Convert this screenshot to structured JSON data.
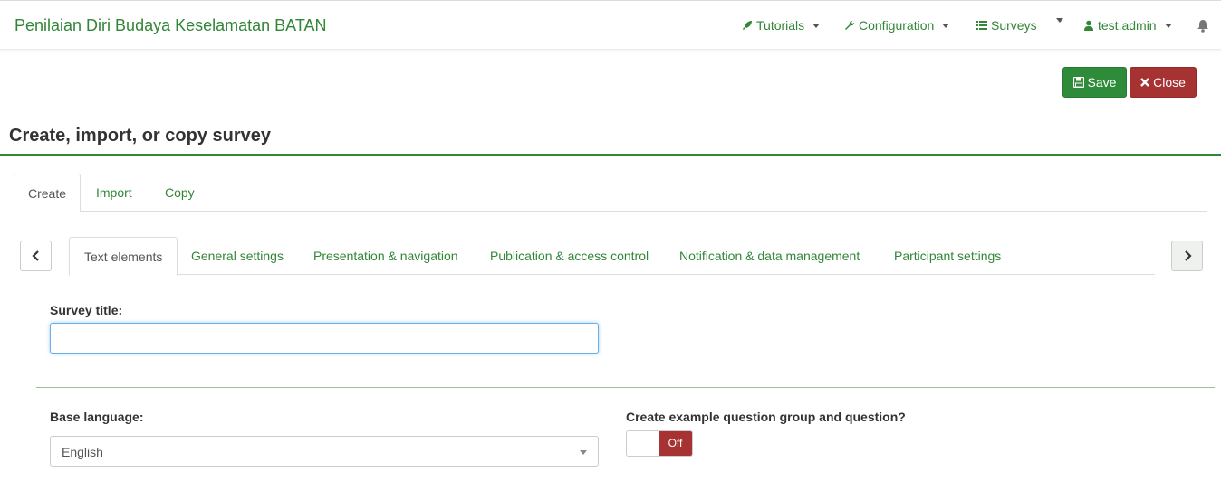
{
  "app": {
    "title": "Penilaian Diri Budaya Keselamatan BATAN"
  },
  "nav": {
    "tutorials": "Tutorials",
    "configuration": "Configuration",
    "surveys": "Surveys",
    "user": "test.admin"
  },
  "toolbar": {
    "save_label": "Save",
    "close_label": "Close"
  },
  "page": {
    "title": "Create, import, or copy survey"
  },
  "tabs": [
    {
      "label": "Create",
      "active": true
    },
    {
      "label": "Import",
      "active": false
    },
    {
      "label": "Copy",
      "active": false
    }
  ],
  "subtabs": [
    {
      "label": "Text elements",
      "active": true
    },
    {
      "label": "General settings",
      "active": false
    },
    {
      "label": "Presentation & navigation",
      "active": false
    },
    {
      "label": "Publication & access control",
      "active": false
    },
    {
      "label": "Notification & data management",
      "active": false
    },
    {
      "label": "Participant settings",
      "active": false
    }
  ],
  "form": {
    "survey_title_label": "Survey title:",
    "survey_title_value": "",
    "base_language_label": "Base language:",
    "base_language_value": "English",
    "example_group_label": "Create example question group and question?",
    "example_group_toggle": "Off"
  },
  "colors": {
    "brand": "#328637",
    "save": "#2e8b3a",
    "close": "#a63232"
  }
}
